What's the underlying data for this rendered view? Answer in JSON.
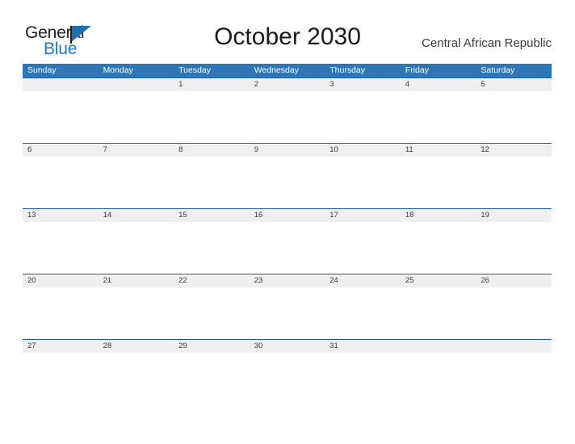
{
  "brand": {
    "name_part1": "General",
    "name_part2": "Blue",
    "flag_icon": "triangle-flag-icon",
    "color_dark": "#231f20",
    "color_blue": "#1f7ac4"
  },
  "header": {
    "title": "October 2030",
    "region": "Central African Republic"
  },
  "calendar": {
    "month": "October",
    "year": "2030",
    "header_color": "#2f76b6",
    "row_border_color": "#1f5fa8",
    "band_color": "#efefef",
    "weekdays": [
      "Sunday",
      "Monday",
      "Tuesday",
      "Wednesday",
      "Thursday",
      "Friday",
      "Saturday"
    ],
    "weeks": [
      [
        "",
        "",
        "1",
        "2",
        "3",
        "4",
        "5"
      ],
      [
        "6",
        "7",
        "8",
        "9",
        "10",
        "11",
        "12"
      ],
      [
        "13",
        "14",
        "15",
        "16",
        "17",
        "18",
        "19"
      ],
      [
        "20",
        "21",
        "22",
        "23",
        "24",
        "25",
        "26"
      ],
      [
        "27",
        "28",
        "29",
        "30",
        "31",
        "",
        ""
      ]
    ]
  }
}
